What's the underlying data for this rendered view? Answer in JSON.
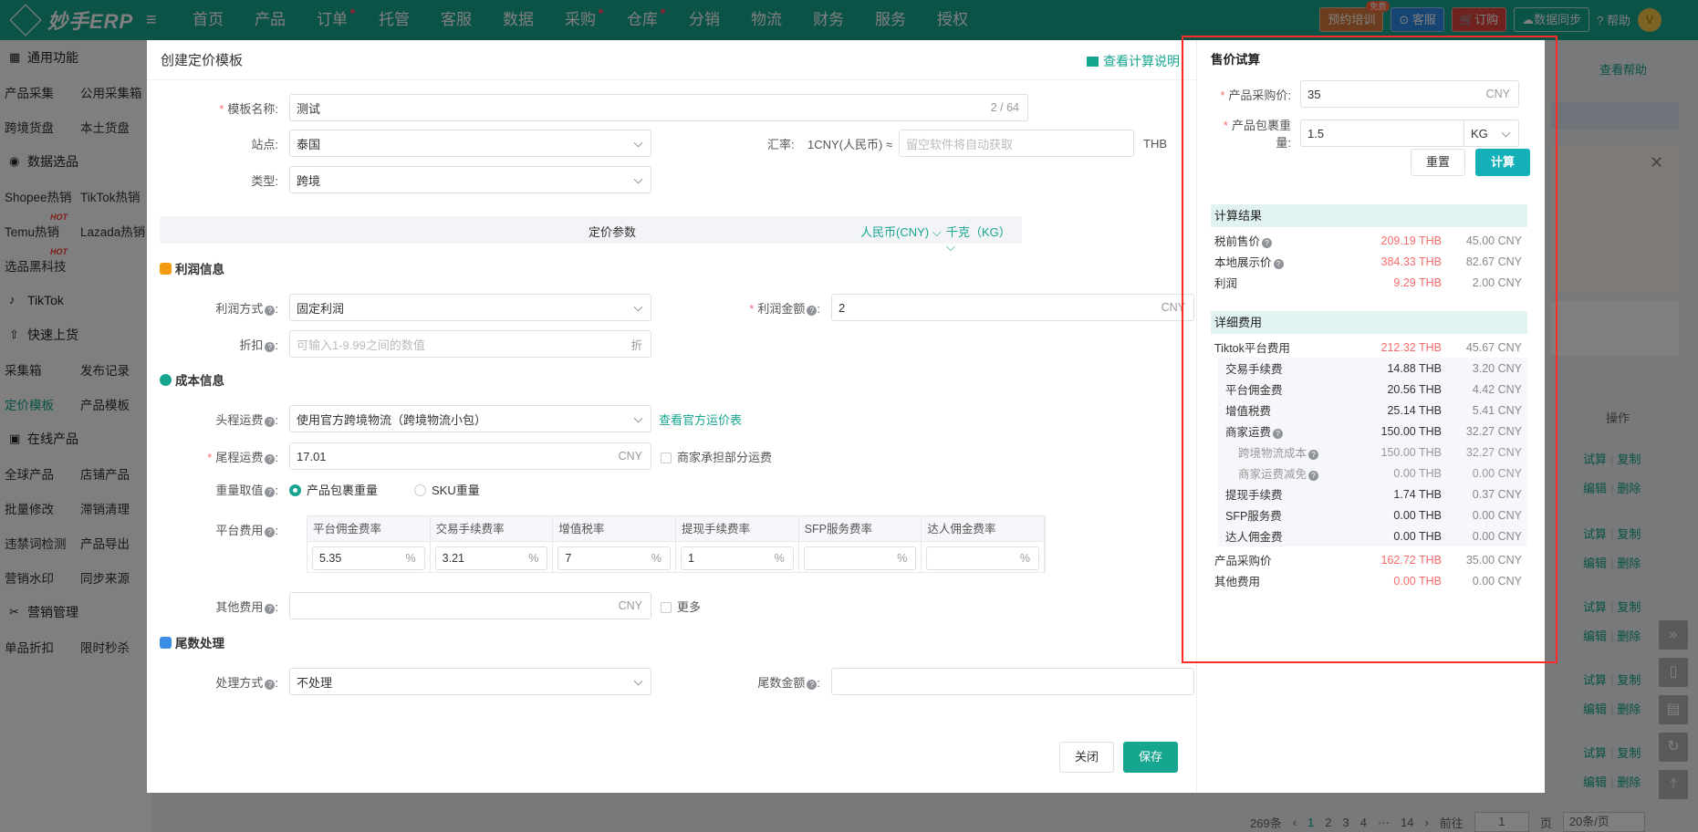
{
  "app": {
    "logo_text": "妙手ERP",
    "nav": [
      "首页",
      "产品",
      "订单",
      "托管",
      "客服",
      "数据",
      "采购",
      "仓库",
      "分销",
      "物流",
      "财务",
      "服务",
      "授权"
    ],
    "nav_dots": [
      false,
      false,
      true,
      false,
      false,
      false,
      true,
      true,
      false,
      false,
      false,
      false,
      false
    ],
    "top_buttons": {
      "training": "预约培训",
      "free_badge": "免费",
      "service": "客服",
      "order": "订购",
      "sync": "数据同步",
      "help": "帮助",
      "avatar": "V"
    }
  },
  "sidebar": {
    "sections": [
      {
        "title": "通用功能",
        "rows": [
          [
            "产品采集",
            "公用采集箱"
          ],
          [
            "跨境货盘",
            "本土货盘"
          ]
        ]
      },
      {
        "title": "数据选品",
        "rows": [
          [
            "Shopee热销",
            "TikTok热销"
          ],
          [
            "Temu热销",
            "Lazada热销"
          ],
          [
            "选品黑科技",
            ""
          ]
        ]
      },
      {
        "title": "TikTok",
        "rows": []
      },
      {
        "title": "快速上货",
        "rows": [
          [
            "采集箱",
            "发布记录"
          ],
          [
            "定价模板",
            "产品模板"
          ]
        ]
      },
      {
        "title": "在线产品",
        "rows": [
          [
            "全球产品",
            "店铺产品"
          ],
          [
            "批量修改",
            "滞销清理"
          ],
          [
            "违禁词检测",
            "产品导出"
          ],
          [
            "营销水印",
            "同步来源"
          ]
        ]
      },
      {
        "title": "营销管理",
        "rows": [
          [
            "单品折扣",
            "限时秒杀"
          ]
        ]
      }
    ],
    "hot_label": "HOT"
  },
  "background": {
    "help": "查看帮助",
    "op_header": "操作",
    "row_links": [
      [
        "试算",
        "复制"
      ],
      [
        "编辑",
        "删除"
      ]
    ],
    "pager": {
      "total": "269条",
      "pages": [
        "1",
        "2",
        "3",
        "4",
        "···",
        "14"
      ],
      "goto": "前往",
      "goto_value": "1",
      "page_unit": "页",
      "per_page": "20条/页"
    }
  },
  "dialog": {
    "title": "创建定价模板",
    "calc_help": "查看计算说明",
    "template_name_label": "模板名称:",
    "template_name_value": "测试",
    "template_name_count": "2 / 64",
    "site_label": "站点:",
    "site_value": "泰国",
    "rate_label": "汇率:",
    "rate_prefix": "1CNY(人民币) ≈",
    "rate_placeholder": "留空软件将自动获取",
    "rate_suffix": "THB",
    "type_label": "类型:",
    "type_value": "跨境",
    "pricing_params": "定价参数",
    "currency_select": "人民币(CNY)",
    "unit_select": "千克（KG）",
    "profit_title": "利润信息",
    "profit_mode_label": "利润方式",
    "profit_mode_value": "固定利润",
    "profit_amount_label": "利润金额",
    "profit_amount_value": "2",
    "profit_amount_suffix": "CNY",
    "discount_label": "折扣",
    "discount_placeholder": "可输入1-9.99之间的数值",
    "discount_suffix": "折",
    "cost_title": "成本信息",
    "first_freight_label": "头程运费",
    "first_freight_value": "使用官方跨境物流（跨境物流小包）",
    "first_freight_link": "查看官方运价表",
    "last_freight_label": "尾程运费",
    "last_freight_value": "17.01",
    "last_freight_suffix": "CNY",
    "merchant_share": "商家承担部分运费",
    "weight_label": "重量取值",
    "weight_opt1": "产品包裹重量",
    "weight_opt2": "SKU重量",
    "platform_fee_label": "平台费用",
    "fees": [
      {
        "head": "平台佣金费率",
        "value": "5.35"
      },
      {
        "head": "交易手续费率",
        "value": "3.21"
      },
      {
        "head": "增值税率",
        "value": "7"
      },
      {
        "head": "提现手续费率",
        "value": "1"
      },
      {
        "head": "SFP服务费率",
        "value": ""
      },
      {
        "head": "达人佣金费率",
        "value": ""
      }
    ],
    "fee_unit": "%",
    "other_fee_label": "其他费用",
    "other_fee_suffix": "CNY",
    "more": "更多",
    "tail_title": "尾数处理",
    "tail_mode_label": "处理方式",
    "tail_mode_value": "不处理",
    "tail_amount_label": "尾数金额",
    "close_btn": "关闭",
    "save_btn": "保存"
  },
  "price_calc": {
    "title": "售价试算",
    "purchase_label": "产品采购价:",
    "purchase_value": "35",
    "purchase_suffix": "CNY",
    "weight_label": "产品包裹重量:",
    "weight_value": "1.5",
    "weight_unit": "KG",
    "reset_btn": "重置",
    "calc_btn": "计算",
    "result_title": "计算结果",
    "results": [
      {
        "label": "税前售价",
        "thb": "209.19 THB",
        "cny": "45.00 CNY",
        "q": true
      },
      {
        "label": "本地展示价",
        "thb": "384.33 THB",
        "cny": "82.67 CNY",
        "q": true
      },
      {
        "label": "利润",
        "thb": "9.29 THB",
        "cny": "2.00 CNY",
        "q": false
      }
    ],
    "detail_title": "详细费用",
    "platform_fee": {
      "label": "Tiktok平台费用",
      "thb": "212.32 THB",
      "cny": "45.67 CNY"
    },
    "details": [
      {
        "label": "交易手续费",
        "thb": "14.88 THB",
        "cny": "3.20 CNY",
        "q": false,
        "sub": false,
        "dim": false
      },
      {
        "label": "平台佣金费",
        "thb": "20.56 THB",
        "cny": "4.42 CNY",
        "q": false,
        "sub": false,
        "dim": false
      },
      {
        "label": "增值税费",
        "thb": "25.14 THB",
        "cny": "5.41 CNY",
        "q": false,
        "sub": false,
        "dim": false
      },
      {
        "label": "商家运费",
        "thb": "150.00 THB",
        "cny": "32.27 CNY",
        "q": true,
        "sub": false,
        "dim": false
      },
      {
        "label": "跨境物流成本",
        "thb": "150.00 THB",
        "cny": "32.27 CNY",
        "q": true,
        "sub": true,
        "dim": true
      },
      {
        "label": "商家运费减免",
        "thb": "0.00 THB",
        "cny": "0.00 CNY",
        "q": true,
        "sub": true,
        "dim": true
      },
      {
        "label": "提现手续费",
        "thb": "1.74 THB",
        "cny": "0.37 CNY",
        "q": false,
        "sub": false,
        "dim": false
      },
      {
        "label": "SFP服务费",
        "thb": "0.00 THB",
        "cny": "0.00 CNY",
        "q": false,
        "sub": false,
        "dim": false
      },
      {
        "label": "达人佣金费",
        "thb": "0.00 THB",
        "cny": "0.00 CNY",
        "q": false,
        "sub": false,
        "dim": false
      }
    ],
    "tail_rows": [
      {
        "label": "产品采购价",
        "thb": "162.72 THB",
        "cny": "35.00 CNY"
      },
      {
        "label": "其他费用",
        "thb": "0.00 THB",
        "cny": "0.00 CNY"
      }
    ]
  }
}
